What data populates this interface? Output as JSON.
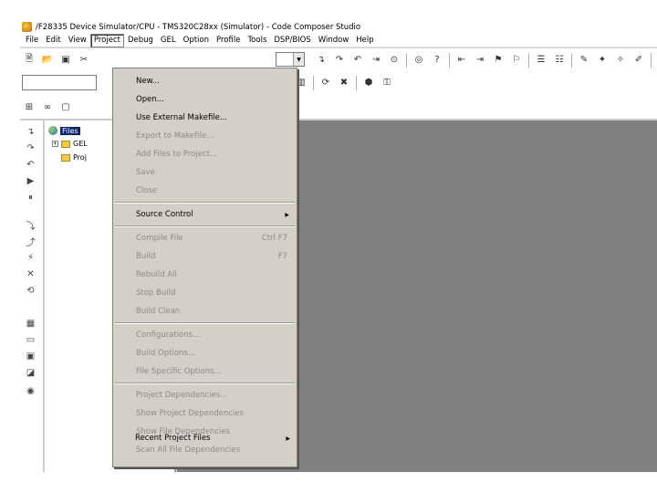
{
  "window": {
    "title": "/F28335 Device Simulator/CPU - TMS320C28xx (Simulator) - Code Composer Studio"
  },
  "menubar": {
    "items": [
      "File",
      "Edit",
      "View",
      "Project",
      "Debug",
      "GEL",
      "Option",
      "Profile",
      "Tools",
      "DSP/BIOS",
      "Window",
      "Help"
    ],
    "active": "Project"
  },
  "project_menu": {
    "items": [
      {
        "label": "New...",
        "enabled": true
      },
      {
        "label": "Open...",
        "enabled": true
      },
      {
        "label": "Use External Makefile...",
        "enabled": true
      },
      {
        "label": "Export to Makefile...",
        "enabled": false
      },
      {
        "label": "Add Files to Project...",
        "enabled": false
      },
      {
        "label": "Save",
        "enabled": false
      },
      {
        "label": "Close",
        "enabled": false
      },
      {
        "label": "Source Control",
        "enabled": true,
        "submenu": true
      },
      {
        "label": "Compile File",
        "shortcut": "Ctrl F7",
        "enabled": false
      },
      {
        "label": "Build",
        "shortcut": "F7",
        "enabled": false
      },
      {
        "label": "Rebuild All",
        "enabled": false
      },
      {
        "label": "Stop Build",
        "enabled": false
      },
      {
        "label": "Build Clean",
        "enabled": false
      },
      {
        "label": "Configurations...",
        "enabled": false
      },
      {
        "label": "Build Options...",
        "enabled": false
      },
      {
        "label": "File Specific Options...",
        "enabled": false
      },
      {
        "label": "Project Dependencies...",
        "enabled": false
      },
      {
        "label": "Show Project Dependencies",
        "enabled": false
      },
      {
        "label": "Show File Dependencies",
        "enabled": false
      },
      {
        "label": "Scan All File Dependencies",
        "enabled": false
      },
      {
        "label": "Recent Project Files",
        "enabled": true,
        "submenu": true
      }
    ]
  },
  "tree": {
    "root": "Files",
    "children": [
      "GEL",
      "Proj"
    ]
  },
  "colors": {
    "workspace": "#808080",
    "selection": "#0a246a"
  }
}
